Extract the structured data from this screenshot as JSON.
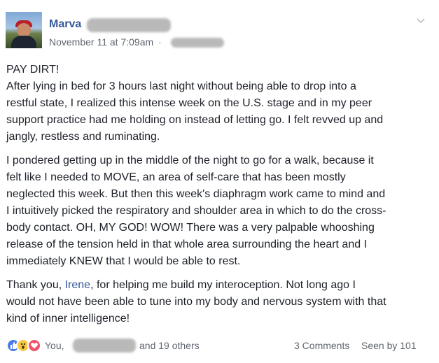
{
  "post": {
    "author_name": "Marva",
    "timestamp": "November 11 at 7:09am",
    "separator": "·",
    "paragraphs": [
      {
        "lines": [
          "PAY DIRT!",
          "After lying in bed for 3 hours last night without being able to drop into a",
          "restful state, I realized this intense week on the U.S. stage and in my peer",
          "support practice had me holding on instead of letting go. I felt revved up and",
          "jangly, restless and ruminating."
        ]
      },
      {
        "lines": [
          "I pondered getting up in the middle of the night to go for a walk, because it",
          "felt like I needed to MOVE, an area of self-care that has been mostly",
          "neglected this week. But then this week's diaphragm work came to mind and",
          "I intuitively picked the respiratory and shoulder area in which to do the cross-",
          "body contact. OH, MY GOD! WOW! There was a very palpable whooshing",
          "release of the tension held in that whole area surrounding the heart and I",
          "immediately KNEW that I would be able to rest."
        ]
      }
    ],
    "last_paragraph": {
      "line1_before": "Thank you, ",
      "mention": "Irene",
      "line1_after": ", for helping me build my interoception. Not long ago I",
      "line2": "would not have been able to tune into my body and nervous system with that",
      "line3": "kind of inner intelligence!"
    }
  },
  "footer": {
    "reactions": [
      "like-icon",
      "wow-icon",
      "love-icon"
    ],
    "reaction_prefix": "You,",
    "reaction_suffix": "and 19 others",
    "comments": "3 Comments",
    "seen": "Seen by 101"
  },
  "colors": {
    "link": "#365899",
    "meta": "#616770",
    "text": "#1d2129"
  }
}
